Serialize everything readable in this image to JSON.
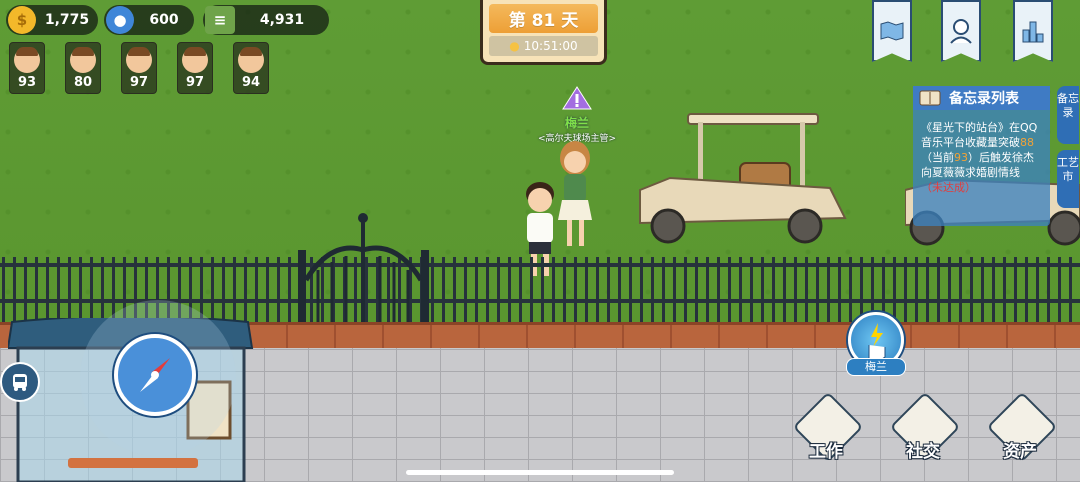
{
  "resources": [
    {
      "name": "gold",
      "icon": "gold-coin-icon",
      "value": "1,775",
      "color": "#f3b82a"
    },
    {
      "name": "fans",
      "icon": "user-icon",
      "value": "600",
      "color": "#3f86d8"
    },
    {
      "name": "cash",
      "icon": "money-icon",
      "value": "4,931",
      "color": "#6fa34a"
    }
  ],
  "npcs": [
    {
      "level": "93"
    },
    {
      "level": "80"
    },
    {
      "level": "97"
    },
    {
      "level": "97"
    },
    {
      "level": "94"
    }
  ],
  "day_panel": {
    "title": "第 81 天",
    "time": "10:51:00"
  },
  "top_right_icons": [
    "map-icon",
    "profile-icon",
    "ranking-icon"
  ],
  "memo": {
    "title": "备忘录列表",
    "line1": "《星光下的站台》在QQ音乐平台收藏量突破",
    "target": "88",
    "current_prefix": "（当前",
    "current": "93",
    "line2": "）后触发徐杰向夏薇薇求婚剧情线",
    "status": "（未达成）"
  },
  "side_tabs": [
    "备忘录",
    "工艺市"
  ],
  "character": {
    "name": "梅兰",
    "title": "<高尔夫球场主管>"
  },
  "interact_button": {
    "label": "梅兰"
  },
  "actions": [
    {
      "label": "工作"
    },
    {
      "label": "社交"
    },
    {
      "label": "资产"
    }
  ]
}
